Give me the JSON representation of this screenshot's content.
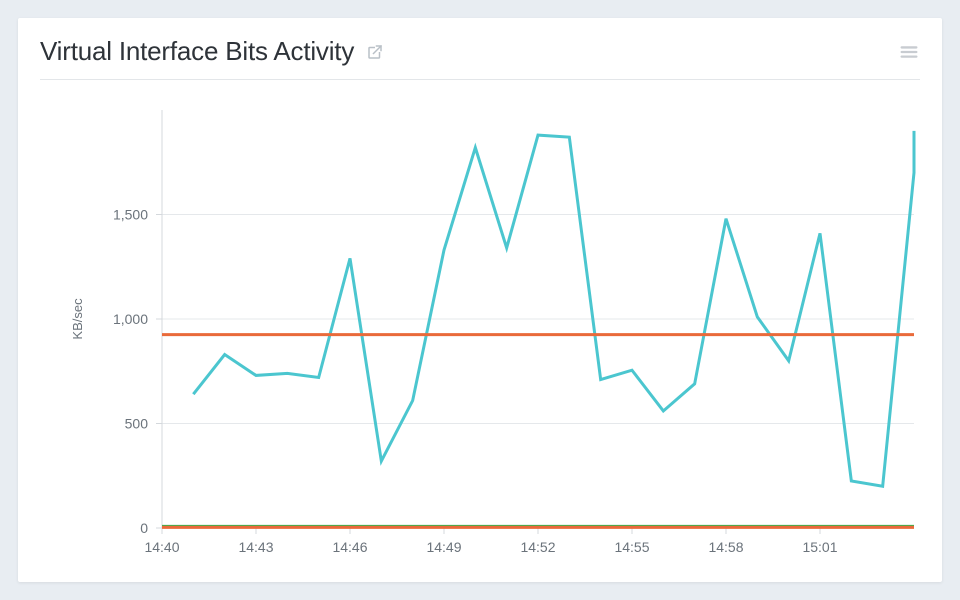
{
  "header": {
    "title": "Virtual Interface Bits Activity"
  },
  "chart_data": {
    "type": "line",
    "ylabel": "KB/sec",
    "xlabel": "",
    "ylim": [
      0,
      2000
    ],
    "xlim": [
      "14:40",
      "15:04"
    ],
    "x_tick_labels": [
      "14:40",
      "14:43",
      "14:46",
      "14:49",
      "14:52",
      "14:55",
      "14:58",
      "15:01"
    ],
    "y_tick_labels": [
      "0",
      "500",
      "1,000",
      "1,500"
    ],
    "y_tick_values": [
      0,
      500,
      1000,
      1500
    ],
    "grid_y": [
      0,
      500,
      1000,
      1500
    ],
    "series": [
      {
        "name": "bits-activity",
        "color": "#4bc6cf",
        "x": [
          "14:41",
          "14:42",
          "14:43",
          "14:44",
          "14:45",
          "14:46",
          "14:47",
          "14:48",
          "14:49",
          "14:50",
          "14:51",
          "14:52",
          "14:53",
          "14:54",
          "14:55",
          "14:56",
          "14:57",
          "14:58",
          "14:59",
          "15:00",
          "15:01",
          "15:02",
          "15:03",
          "15:04"
        ],
        "y": [
          640,
          830,
          730,
          740,
          720,
          1290,
          320,
          610,
          1330,
          1820,
          1340,
          1880,
          1870,
          710,
          755,
          560,
          690,
          1480,
          1010,
          800,
          1410,
          225,
          200,
          1700
        ]
      },
      {
        "name": "threshold-high",
        "color": "#e96a3a",
        "x": [
          "14:40",
          "15:04"
        ],
        "y": [
          925,
          925
        ]
      },
      {
        "name": "baseline-green",
        "color": "#3fae4a",
        "x": [
          "14:40",
          "15:04"
        ],
        "y": [
          8,
          8
        ]
      },
      {
        "name": "baseline-orange",
        "color": "#e96a3a",
        "x": [
          "14:40",
          "15:04"
        ],
        "y": [
          3,
          3
        ]
      }
    ]
  }
}
